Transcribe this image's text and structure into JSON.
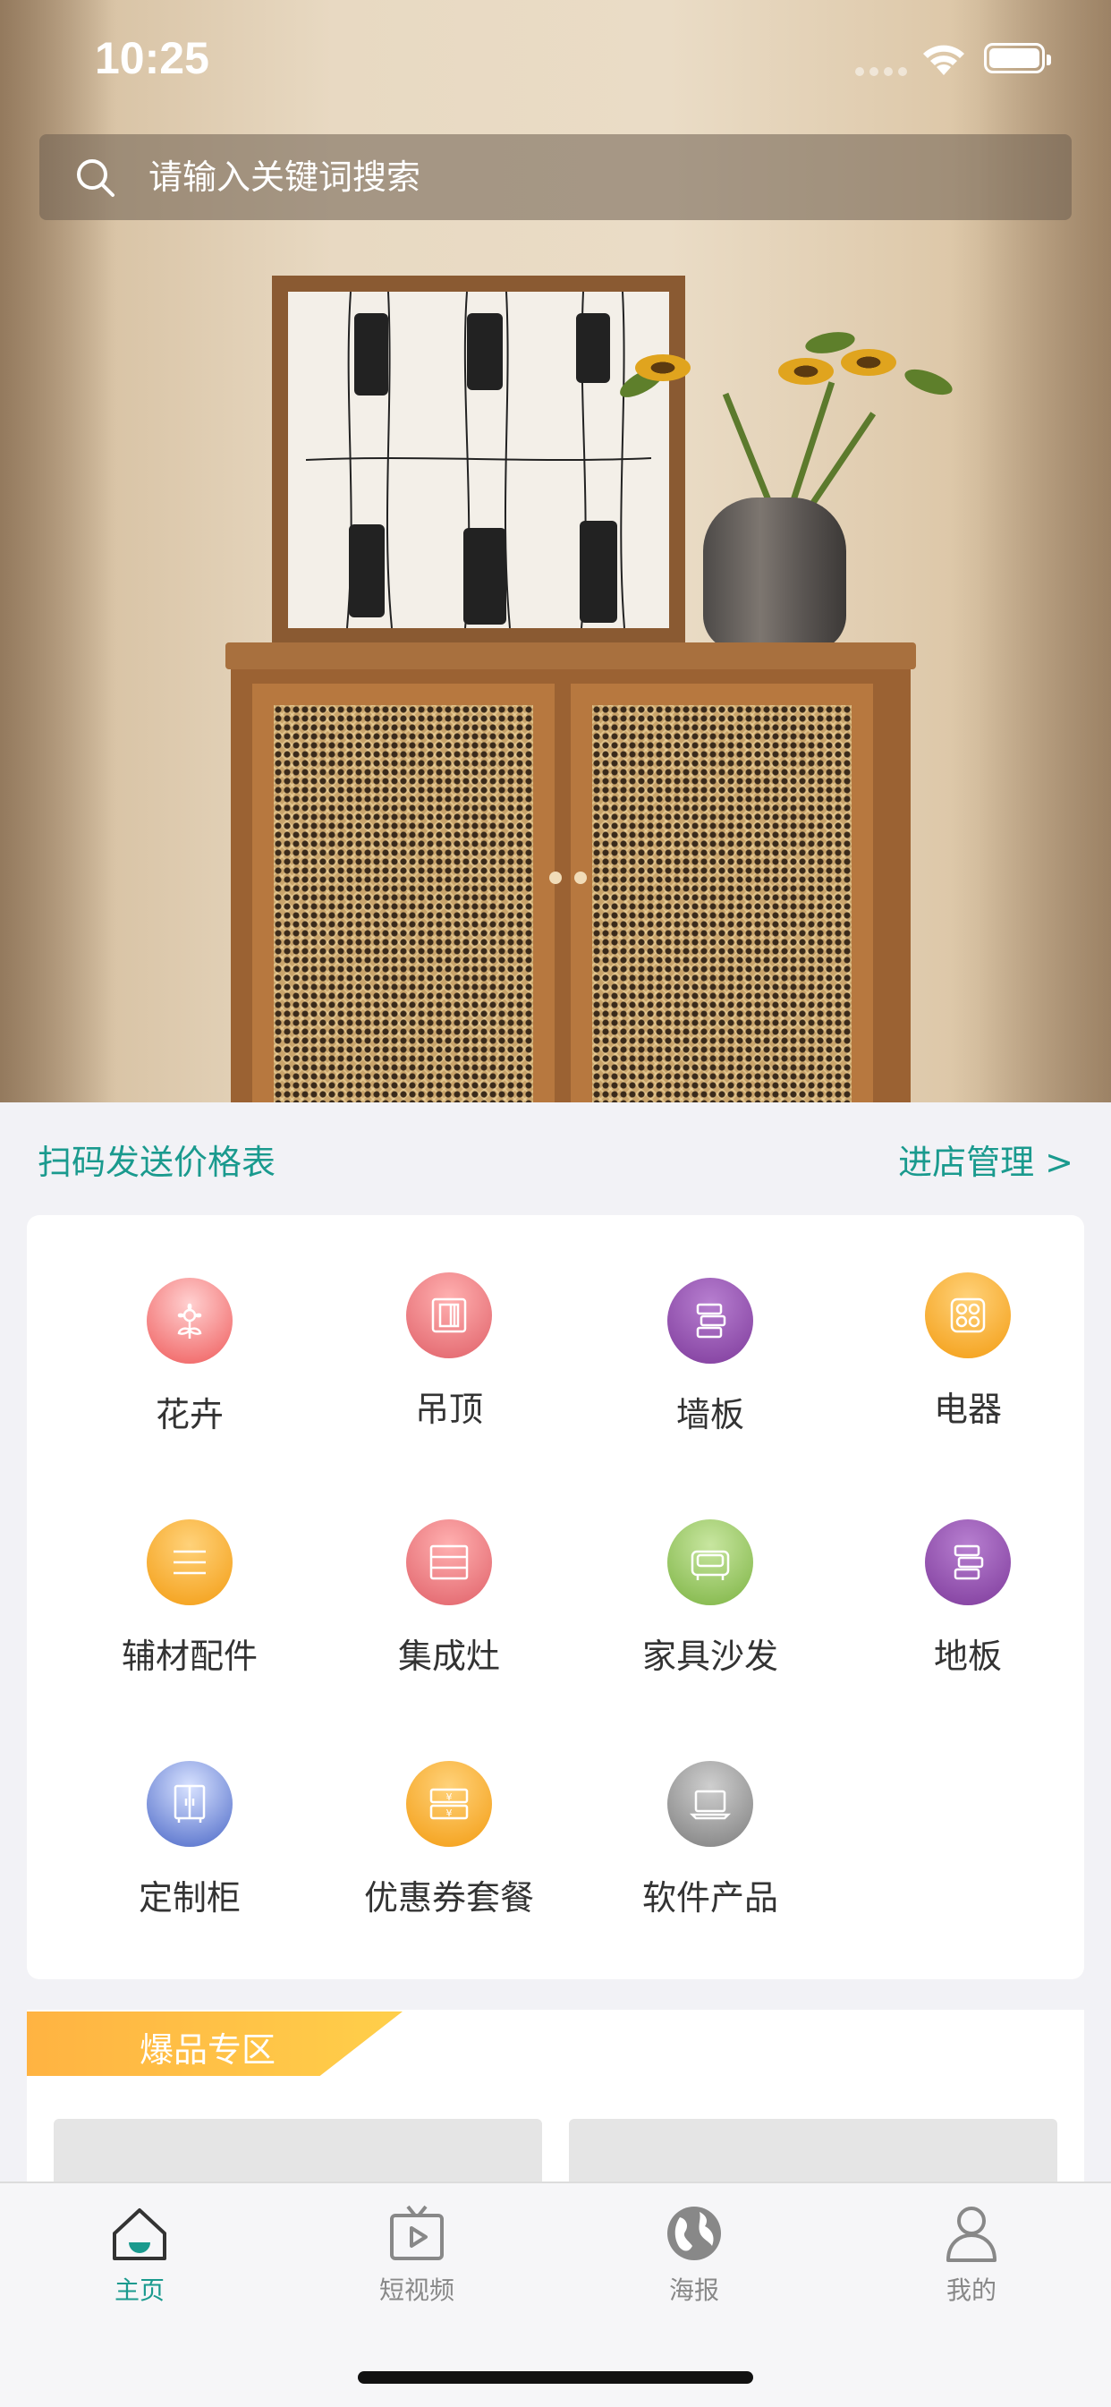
{
  "status_bar": {
    "time": "10:25"
  },
  "search": {
    "placeholder": "请输入关键词搜索"
  },
  "links": {
    "scan": "扫码发送价格表",
    "store": "进店管理 >"
  },
  "categories": [
    {
      "label": "花卉",
      "icon": "flower-icon",
      "color": "#ef5a5a"
    },
    {
      "label": "吊顶",
      "icon": "ceiling-icon",
      "color": "#e8666d"
    },
    {
      "label": "墙板",
      "icon": "wallboard-icon",
      "color": "#8e44ad"
    },
    {
      "label": "电器",
      "icon": "appliance-icon",
      "color": "#f5a623"
    },
    {
      "label": "辅材配件",
      "icon": "list-icon",
      "color": "#f5a623"
    },
    {
      "label": "集成灶",
      "icon": "stove-icon",
      "color": "#e8666d"
    },
    {
      "label": "家具沙发",
      "icon": "sofa-icon",
      "color": "#8bc34a"
    },
    {
      "label": "地板",
      "icon": "floor-icon",
      "color": "#8e44ad"
    },
    {
      "label": "定制柜",
      "icon": "cabinet-icon",
      "color": "#4a67c7"
    },
    {
      "label": "优惠券套餐",
      "icon": "coupon-icon",
      "color": "#f5a623"
    },
    {
      "label": "软件产品",
      "icon": "laptop-icon",
      "color": "#888888"
    }
  ],
  "hot_zone": {
    "title": "爆品专区"
  },
  "tabs": [
    {
      "label": "主页",
      "icon": "home-icon",
      "active": true
    },
    {
      "label": "短视频",
      "icon": "video-icon",
      "active": false
    },
    {
      "label": "海报",
      "icon": "globe-icon",
      "active": false
    },
    {
      "label": "我的",
      "icon": "user-icon",
      "active": false
    }
  ],
  "accent": "#1a9a8e"
}
